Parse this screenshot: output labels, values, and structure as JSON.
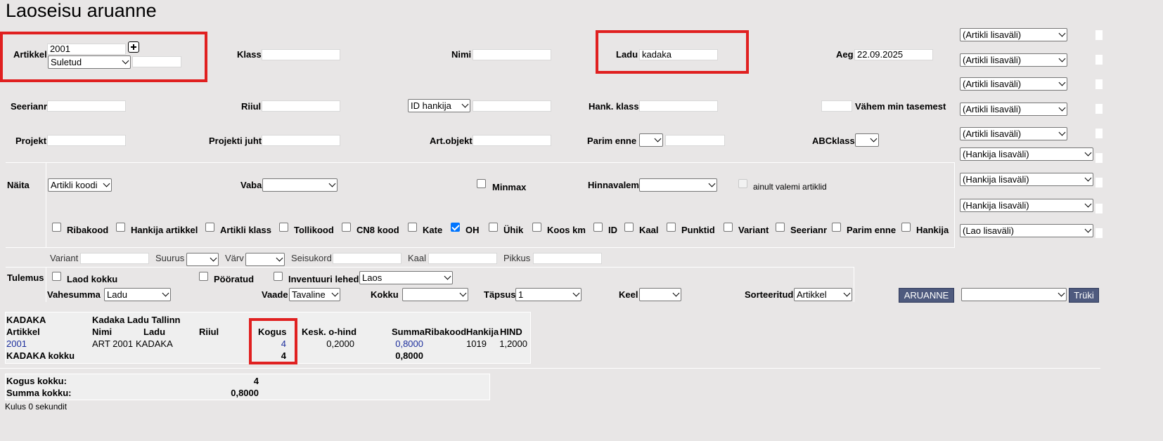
{
  "page": {
    "title": "Laoseisu aruanne"
  },
  "filters": {
    "artikkel": {
      "label": "Artikkel",
      "value": "2001",
      "status": "Suletud",
      "extra": ""
    },
    "klass": {
      "label": "Klass",
      "value": ""
    },
    "nimi": {
      "label": "Nimi",
      "value": ""
    },
    "ladu": {
      "label": "Ladu",
      "value": "kadaka"
    },
    "aeg": {
      "label": "Aeg",
      "value": "22.09.2025"
    },
    "seerianr": {
      "label": "Seerianr",
      "value": ""
    },
    "riiul": {
      "label": "Riiul",
      "value": ""
    },
    "id_hankija": {
      "selected": "ID hankija",
      "value": ""
    },
    "hank_klass": {
      "label": "Hank. klass",
      "value": ""
    },
    "vahem_min": {
      "label": "Vähem min tasemest",
      "value": ""
    },
    "projekt": {
      "label": "Projekt",
      "value": ""
    },
    "projekti_juht": {
      "label": "Projekti juht",
      "value": ""
    },
    "art_objekt": {
      "label": "Art.objekt",
      "value": ""
    },
    "parim_enne": {
      "label": "Parim enne",
      "selected": "",
      "value": ""
    },
    "abcklass": {
      "label": "ABCklass",
      "selected": ""
    }
  },
  "side_selects": [
    "(Artikli lisaväli)",
    "(Artikli lisaväli)",
    "(Artikli lisaväli)",
    "(Artikli lisaväli)",
    "(Artikli lisaväli)",
    "(Hankija lisaväli)",
    "(Hankija lisaväli)",
    "(Hankija lisaväli)",
    "(Lao lisaväli)"
  ],
  "naita": {
    "label": "Näita",
    "kood_select": "Artikli koodi",
    "vaba_label": "Vaba",
    "vaba_select": "",
    "minmax_label": "Minmax",
    "hinnavalem_label": "Hinnavalem",
    "hinnavalem_select": "",
    "ainult_label": "ainult valemi artiklid",
    "checkboxes": [
      {
        "label": "Ribakood",
        "checked": false
      },
      {
        "label": "Hankija artikkel",
        "checked": false
      },
      {
        "label": "Artikli klass",
        "checked": false
      },
      {
        "label": "Tollikood",
        "checked": false
      },
      {
        "label": "CN8 kood",
        "checked": false
      },
      {
        "label": "Kate",
        "checked": false
      },
      {
        "label": "OH",
        "checked": true
      },
      {
        "label": "Ühik",
        "checked": false
      },
      {
        "label": "Koos km",
        "checked": false
      },
      {
        "label": "ID",
        "checked": false
      },
      {
        "label": "Kaal",
        "checked": false
      },
      {
        "label": "Punktid",
        "checked": false
      },
      {
        "label": "Variant",
        "checked": false
      },
      {
        "label": "Seerianr",
        "checked": false
      },
      {
        "label": "Parim enne",
        "checked": false
      },
      {
        "label": "Hankija",
        "checked": false
      }
    ]
  },
  "attributes": {
    "variant": "Variant",
    "suurus": "Suurus",
    "varv": "Värv",
    "seisukord": "Seisukord",
    "kaal": "Kaal",
    "pikkus": "Pikkus"
  },
  "tulemus": {
    "label": "Tulemus",
    "laod_kokku": "Laod kokku",
    "pooratud": "Pööratud",
    "inventuuri": "Inventuuri lehed",
    "laos_select": "Laos",
    "vahesumma_label": "Vahesumma",
    "vahesumma_select": "Ladu",
    "vaade_label": "Vaade",
    "vaade_select": "Tavaline",
    "kokku_label": "Kokku",
    "kokku_select": "",
    "tapsus_label": "Täpsus",
    "tapsus_select": "1",
    "keel_label": "Keel",
    "keel_select": "",
    "sorteeritud_label": "Sorteeritud",
    "sorteeritud_select": "Artikkel",
    "aruanne_button": "ARUANNE",
    "print_select": "",
    "trüki_button": "Trüki"
  },
  "report": {
    "warehouse_code": "KADAKA",
    "warehouse_name": "Kadaka Ladu Tallinn",
    "headers": [
      "Artikkel",
      "Nimi",
      "Ladu",
      "Riiul",
      "Kogus",
      "Kesk. o-hind",
      "Summa",
      "Ribakood",
      "Hankija",
      "HIND"
    ],
    "rows": [
      {
        "artikkel": "2001",
        "nimi": "ART 2001",
        "ladu": "KADAKA",
        "riiul": "",
        "kogus": "4",
        "kesk": "0,2000",
        "summa": "0,8000",
        "ribakood": "",
        "hankija": "1019",
        "hind": "1,2000"
      }
    ],
    "subtotal_label": "KADAKA kokku",
    "subtotal_kogus": "4",
    "subtotal_summa": "0,8000"
  },
  "totals": {
    "kogus_label": "Kogus kokku:",
    "kogus_value": "4",
    "summa_label": "Summa kokku:",
    "summa_value": "0,8000"
  },
  "footer": {
    "timing": "Kulus 0 sekundit"
  }
}
